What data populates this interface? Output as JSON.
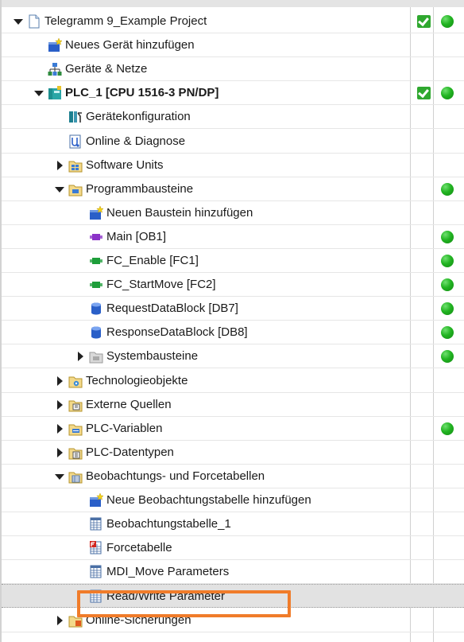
{
  "tree": {
    "items": [
      {
        "label": "Telegramm 9_Example Project",
        "expander": "down",
        "icon": "project-icon",
        "check": true,
        "dot": true
      },
      {
        "label": "Neues Gerät hinzufügen",
        "expander": "",
        "icon": "add-new-icon",
        "check": false,
        "dot": false
      },
      {
        "label": "Geräte & Netze",
        "expander": "",
        "icon": "network-icon",
        "check": false,
        "dot": false
      },
      {
        "label": "PLC_1 [CPU 1516-3 PN/DP]",
        "expander": "down",
        "icon": "plc-icon",
        "check": true,
        "dot": true
      },
      {
        "label": "Gerätekonfiguration",
        "expander": "",
        "icon": "device-config-icon",
        "check": false,
        "dot": false
      },
      {
        "label": "Online & Diagnose",
        "expander": "",
        "icon": "diagnostics-icon",
        "check": false,
        "dot": false
      },
      {
        "label": "Software Units",
        "expander": "right",
        "icon": "folder-units-icon",
        "check": false,
        "dot": false
      },
      {
        "label": "Programmbausteine",
        "expander": "down",
        "icon": "folder-blocks-icon",
        "check": false,
        "dot": true
      },
      {
        "label": "Neuen Baustein hinzufügen",
        "expander": "",
        "icon": "add-new-icon",
        "check": false,
        "dot": false
      },
      {
        "label": "Main [OB1]",
        "expander": "",
        "icon": "ob-block-icon",
        "check": false,
        "dot": true
      },
      {
        "label": "FC_Enable [FC1]",
        "expander": "",
        "icon": "fc-block-icon",
        "check": false,
        "dot": true
      },
      {
        "label": "FC_StartMove [FC2]",
        "expander": "",
        "icon": "fc-block-icon",
        "check": false,
        "dot": true
      },
      {
        "label": "RequestDataBlock [DB7]",
        "expander": "",
        "icon": "db-block-icon",
        "check": false,
        "dot": true
      },
      {
        "label": "ResponseDataBlock [DB8]",
        "expander": "",
        "icon": "db-block-icon",
        "check": false,
        "dot": true
      },
      {
        "label": "Systembausteine",
        "expander": "right",
        "icon": "folder-system-icon",
        "check": false,
        "dot": true
      },
      {
        "label": "Technologieobjekte",
        "expander": "right",
        "icon": "folder-tech-icon",
        "check": false,
        "dot": false
      },
      {
        "label": "Externe Quellen",
        "expander": "right",
        "icon": "folder-external-icon",
        "check": false,
        "dot": false
      },
      {
        "label": "PLC-Variablen",
        "expander": "right",
        "icon": "folder-tags-icon",
        "check": false,
        "dot": true
      },
      {
        "label": "PLC-Datentypen",
        "expander": "right",
        "icon": "folder-datatypes-icon",
        "check": false,
        "dot": false
      },
      {
        "label": "Beobachtungs- und Forcetabellen",
        "expander": "down",
        "icon": "folder-watch-icon",
        "check": false,
        "dot": false
      },
      {
        "label": "Neue Beobachtungstabelle hinzufügen",
        "expander": "",
        "icon": "add-new-icon",
        "check": false,
        "dot": false
      },
      {
        "label": "Beobachtungstabelle_1",
        "expander": "",
        "icon": "watch-table-icon",
        "check": false,
        "dot": false
      },
      {
        "label": "Forcetabelle",
        "expander": "",
        "icon": "force-table-icon",
        "check": false,
        "dot": false
      },
      {
        "label": "MDI_Move Parameters",
        "expander": "",
        "icon": "watch-table-icon",
        "check": false,
        "dot": false
      },
      {
        "label": "Read/Write Parameter",
        "expander": "",
        "icon": "watch-table-icon",
        "check": false,
        "dot": false,
        "selected": true
      },
      {
        "label": "Online-Sicherungen",
        "expander": "right",
        "icon": "folder-backup-icon",
        "check": false,
        "dot": false
      }
    ]
  }
}
